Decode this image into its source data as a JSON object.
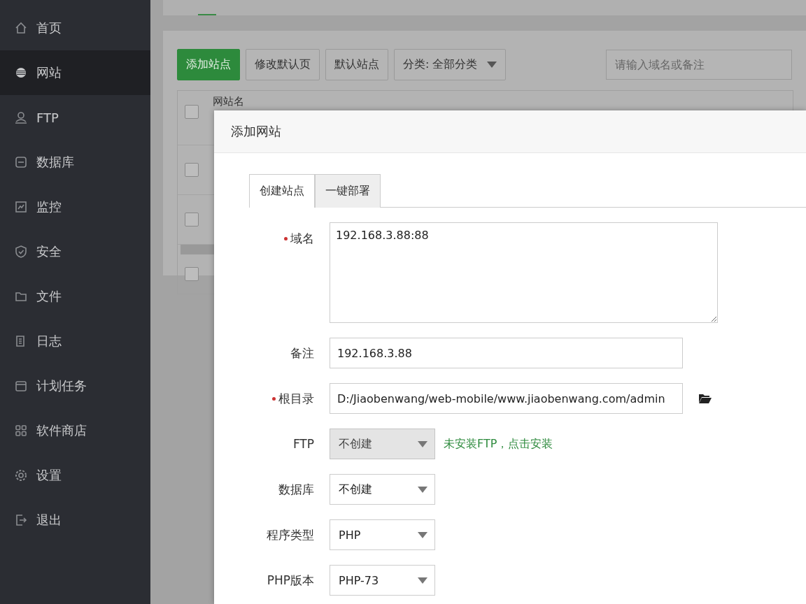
{
  "sidebar": {
    "items": [
      {
        "label": "首页",
        "selected": false
      },
      {
        "label": "网站",
        "selected": true
      },
      {
        "label": "FTP",
        "selected": false
      },
      {
        "label": "数据库",
        "selected": false
      },
      {
        "label": "监控",
        "selected": false
      },
      {
        "label": "安全",
        "selected": false
      },
      {
        "label": "文件",
        "selected": false
      },
      {
        "label": "日志",
        "selected": false
      },
      {
        "label": "计划任务",
        "selected": false
      },
      {
        "label": "软件商店",
        "selected": false
      },
      {
        "label": "设置",
        "selected": false
      },
      {
        "label": "退出",
        "selected": false
      }
    ]
  },
  "toolbar": {
    "buttons": [
      {
        "label": "添加站点",
        "kind": "primary"
      },
      {
        "label": "修改默认页",
        "kind": "default"
      },
      {
        "label": "默认站点",
        "kind": "default"
      },
      {
        "label": "分类: 全部分类",
        "kind": "dropdown"
      }
    ],
    "search": {
      "placeholder": "请输入域名或备注"
    }
  },
  "table": {
    "columns": [
      "网站名"
    ],
    "header_checked": false,
    "rows": [
      {
        "checked": false
      },
      {
        "checked": false
      }
    ],
    "footer": {
      "checked": false
    }
  },
  "dialog": {
    "title": "添加网站",
    "tabs": [
      {
        "label": "创建站点",
        "selected": true
      },
      {
        "label": "一键部署",
        "selected": false
      }
    ],
    "fields": [
      {
        "label": "域名",
        "required": true,
        "kind": "textarea",
        "value": "192.168.3.88:88"
      },
      {
        "label": "备注",
        "required": false,
        "kind": "text",
        "value": "192.168.3.88"
      },
      {
        "label": "根目录",
        "required": true,
        "kind": "path",
        "value": "D:/Jiaobenwang/web-mobile/www.jiaobenwang.com/admin"
      },
      {
        "label": "FTP",
        "required": false,
        "kind": "select",
        "value": "不创建",
        "disabled": true,
        "note": "未安装FTP，点击安装"
      },
      {
        "label": "数据库",
        "required": false,
        "kind": "select",
        "value": "不创建",
        "disabled": false
      },
      {
        "label": "程序类型",
        "required": false,
        "kind": "select",
        "value": "PHP",
        "disabled": false
      },
      {
        "label": "PHP版本",
        "required": false,
        "kind": "select",
        "value": "PHP-73",
        "disabled": false
      }
    ]
  }
}
